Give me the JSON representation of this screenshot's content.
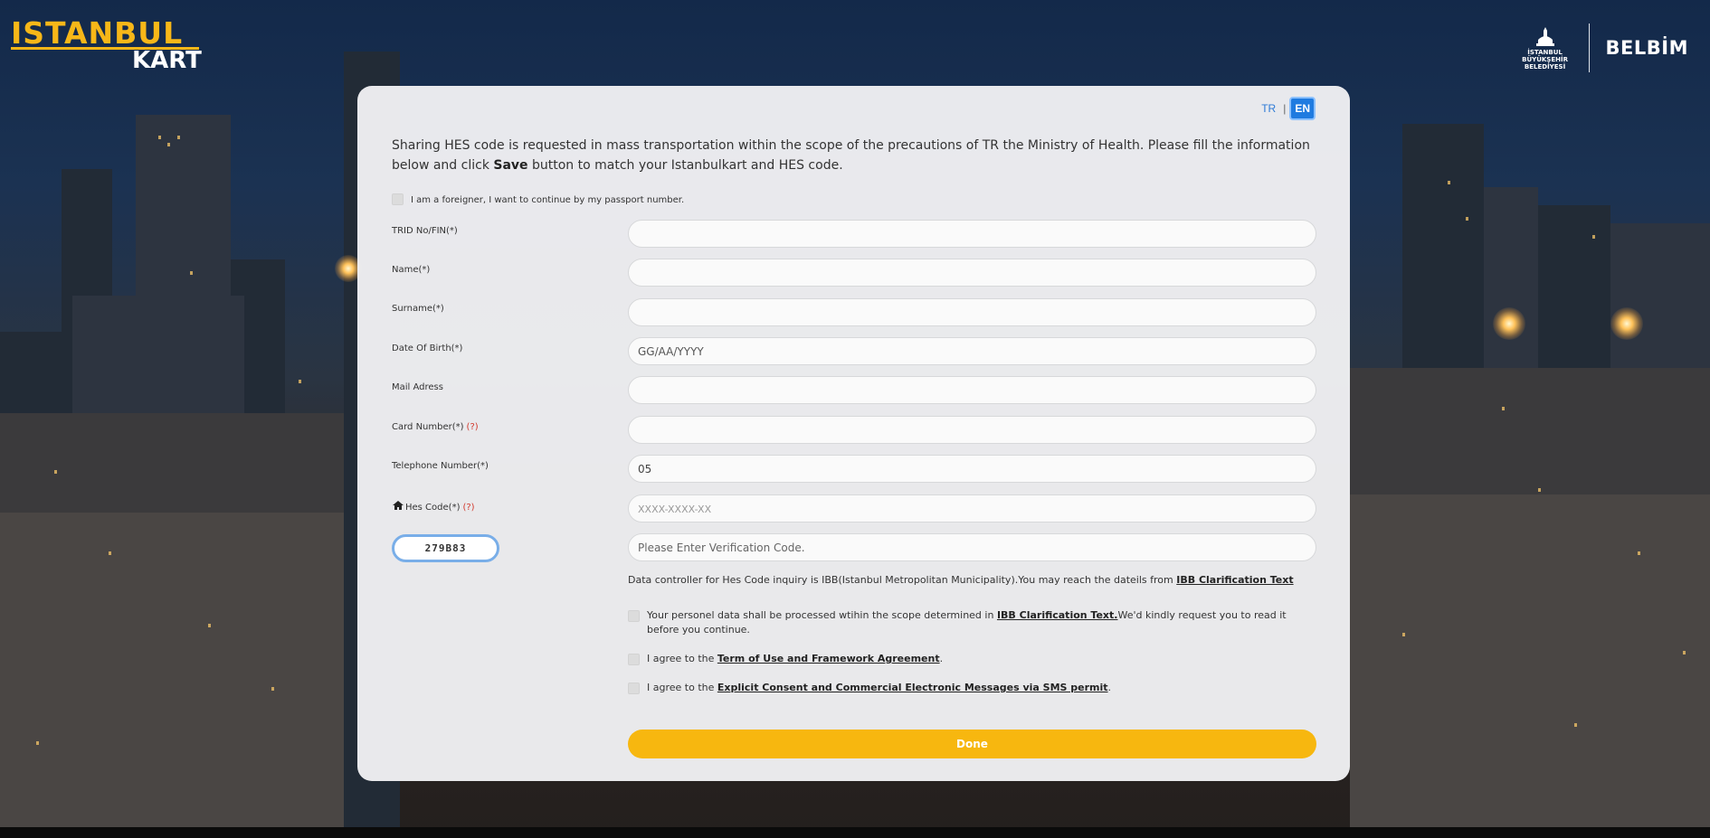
{
  "header": {
    "logo_line1": "ISTANBUL",
    "logo_line2": "KART",
    "ibb_line1": "İSTANBUL",
    "ibb_line2": "BÜYÜKŞEHİR",
    "ibb_line3": "BELEDİYESİ",
    "belbim": "BELBİM"
  },
  "lang": {
    "tr": "TR",
    "separator": "|",
    "en": "EN",
    "active": "EN"
  },
  "intro": {
    "part1": "Sharing HES code is requested in mass transportation within the scope of the precautions of TR the Ministry of Health. Please fill the information below and click ",
    "bold": "Save",
    "part2": " button to match your Istanbulkart and HES code."
  },
  "foreigner_label": "I am a foreigner, I want to continue by my passport number.",
  "fields": {
    "trid": {
      "label": "TRID No/FIN(*)",
      "value": "",
      "placeholder": ""
    },
    "name": {
      "label": "Name(*)",
      "value": "",
      "placeholder": ""
    },
    "surname": {
      "label": "Surname(*)",
      "value": "",
      "placeholder": ""
    },
    "dob": {
      "label": "Date Of Birth(*)",
      "value": "",
      "placeholder": "GG/AA/YYYY"
    },
    "mail": {
      "label": "Mail Adress",
      "value": "",
      "placeholder": ""
    },
    "card": {
      "label": "Card Number(*)",
      "help": "(?)",
      "value": "",
      "placeholder": ""
    },
    "phone": {
      "label": "Telephone Number(*)",
      "value": "05",
      "placeholder": ""
    },
    "hes": {
      "label": "Hes Code(*)",
      "help": "(?)",
      "value": "",
      "placeholder": "XXXX-XXXX-XX"
    },
    "verification": {
      "captcha": "279B83",
      "placeholder": "Please Enter Verification Code."
    }
  },
  "notice": {
    "text": "Data controller for Hes Code inquiry is IBB(Istanbul Metropolitan Municipality).You may reach the dateils from ",
    "link": "IBB Clarification Text"
  },
  "agreements": {
    "personal": {
      "prefix": "Your personel data shall be processed wtihin the scope determined in ",
      "link": "IBB Clarification Text.",
      "suffix": "We'd kindly request you to read it before you continue."
    },
    "terms": {
      "prefix": "I agree to the ",
      "link": "Term of Use and Framework Agreement",
      "suffix": "."
    },
    "sms": {
      "prefix": "I agree to the ",
      "link": "Explicit Consent and Commercial Electronic Messages via SMS permit",
      "suffix": "."
    }
  },
  "done_label": "Done",
  "colors": {
    "accent": "#f7b70f",
    "link_blue": "#1f7be0",
    "help_red": "#d23a2e"
  }
}
